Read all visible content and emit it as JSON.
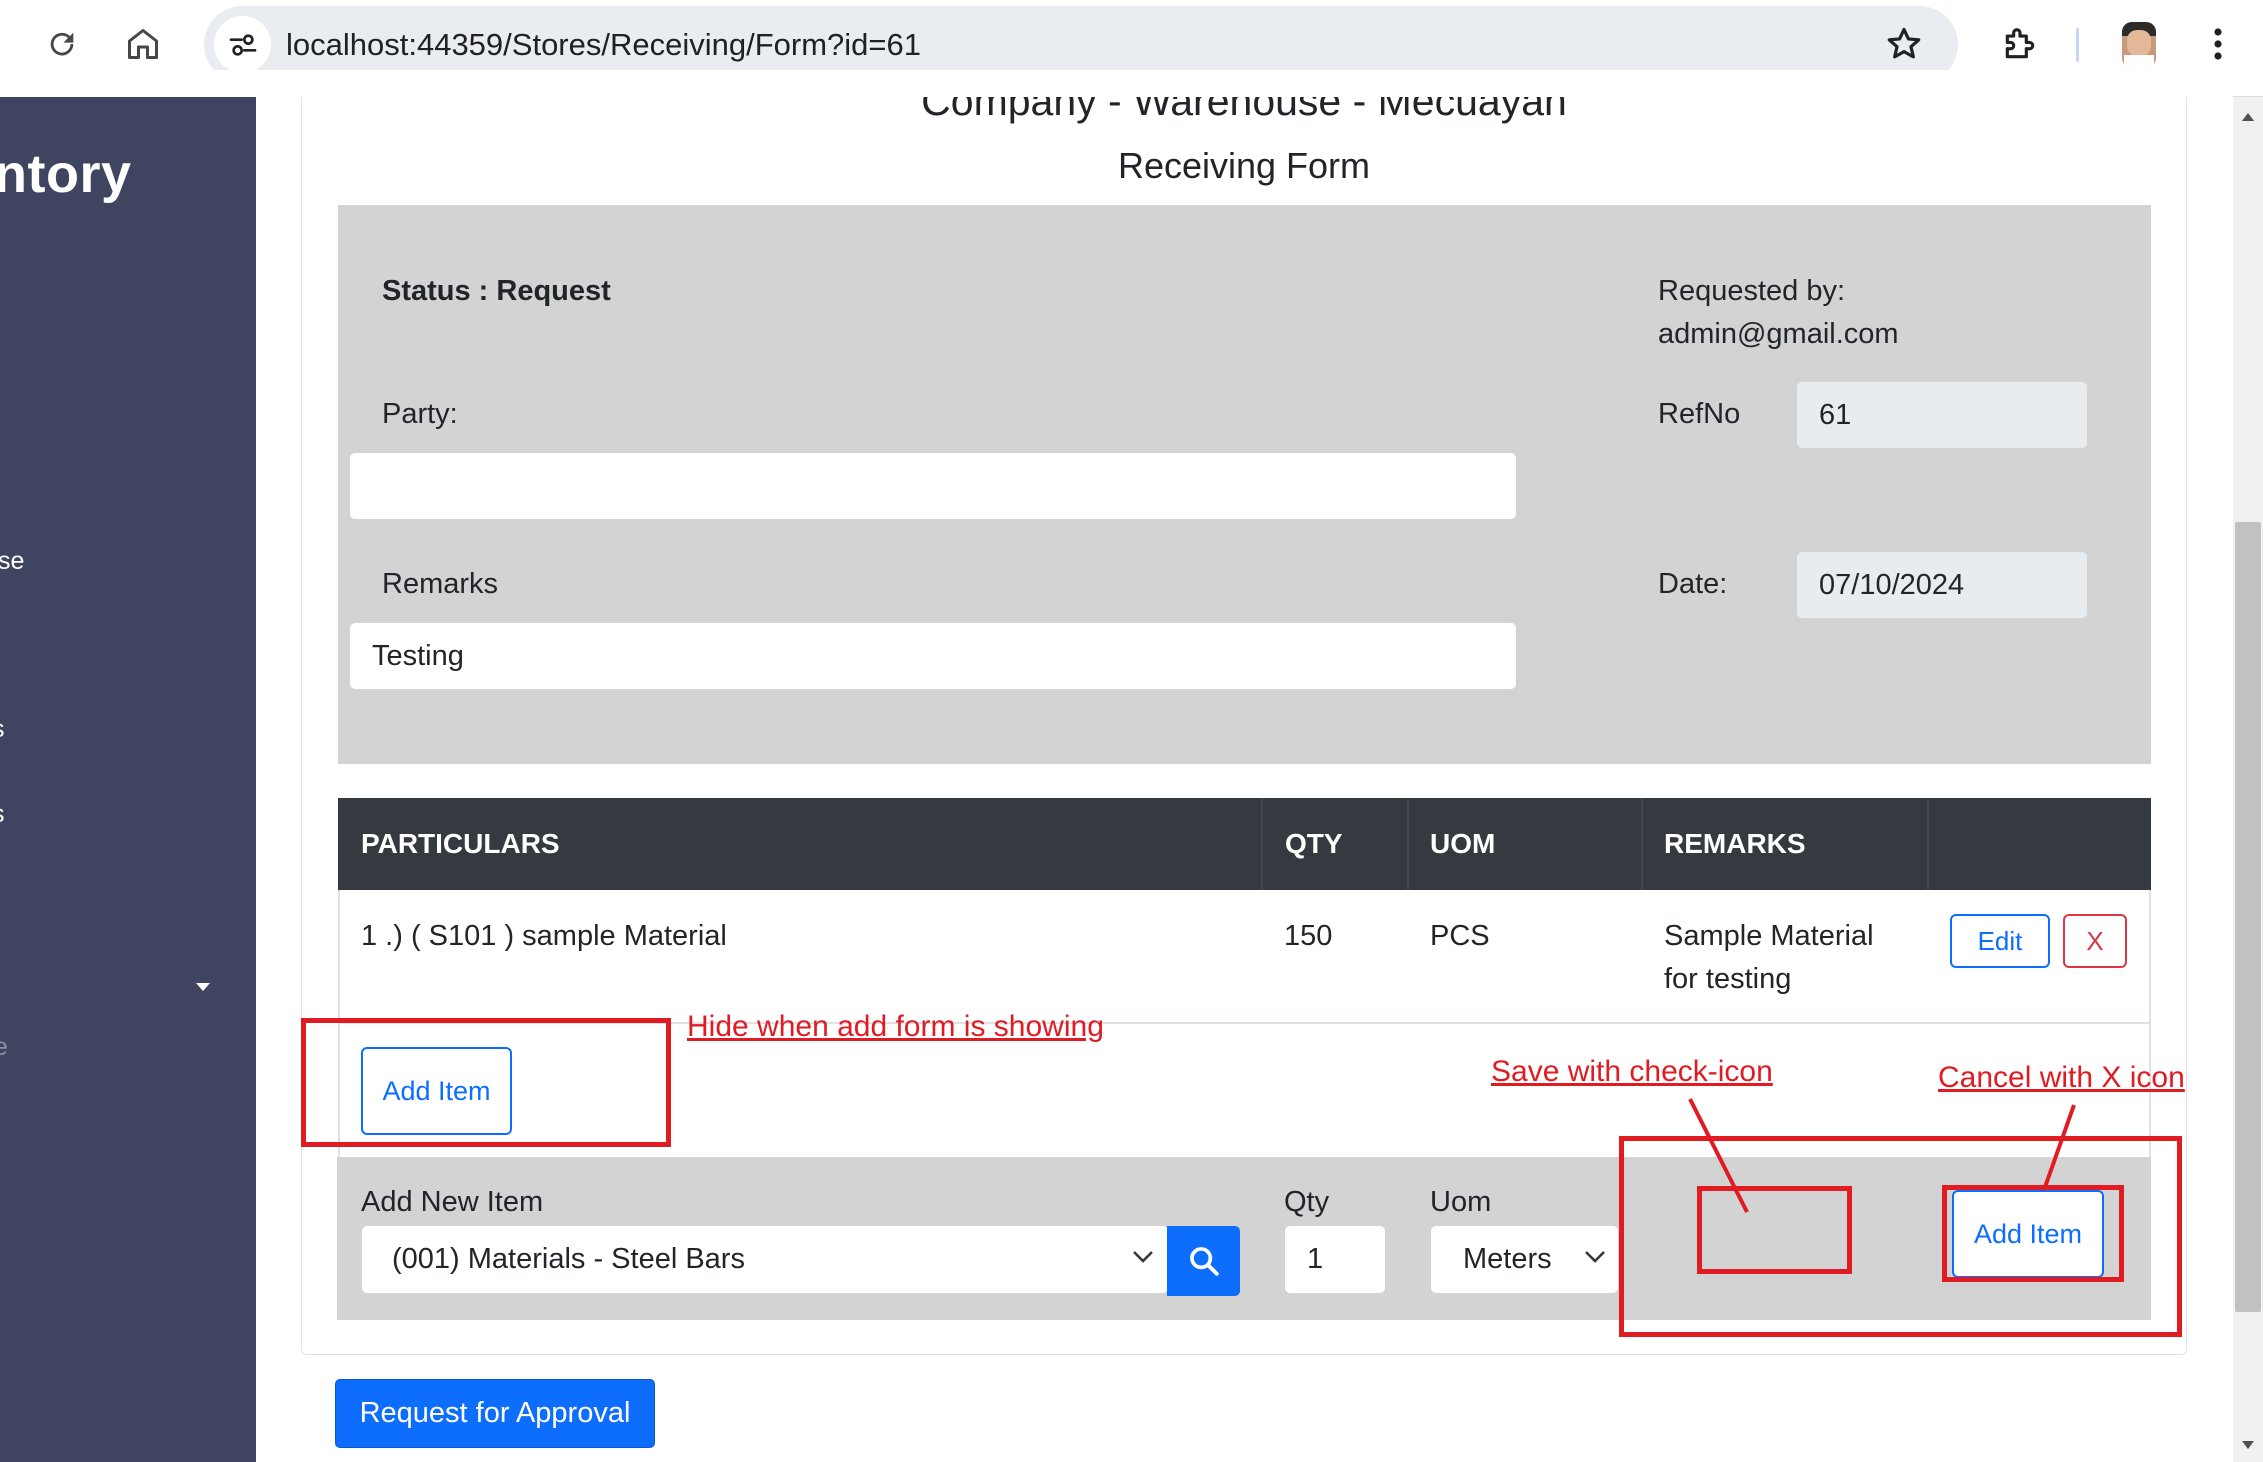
{
  "browser": {
    "url": "localhost:44359/Stores/Receiving/Form?id=61"
  },
  "sidebar": {
    "brand_fragment": "ntory",
    "items": [
      {
        "label": "se"
      },
      {
        "label": "s"
      },
      {
        "label": "s"
      },
      {
        "label": "e"
      }
    ]
  },
  "page": {
    "company_title": "Company - Warehouse - Mecuayan",
    "form_title": "Receiving Form"
  },
  "header_form": {
    "status_label": "Status : Request",
    "requested_by_label": "Requested by:",
    "requested_by_value": "admin@gmail.com",
    "party_label": "Party:",
    "party_value": "",
    "refno_label": "RefNo",
    "refno_value": "61",
    "remarks_label": "Remarks",
    "remarks_value": "Testing",
    "date_label": "Date:",
    "date_value": "07/10/2024"
  },
  "table": {
    "headers": [
      "PARTICULARS",
      "QTY",
      "UOM",
      "REMARKS"
    ],
    "rows": [
      {
        "particulars": "1 .) ( S101 ) sample Material",
        "qty": "150",
        "uom": "PCS",
        "remarks_line1": "Sample Material",
        "remarks_line2": "for testing",
        "edit_label": "Edit",
        "delete_label": "X"
      }
    ],
    "add_item_label": "Add Item"
  },
  "add_form": {
    "item_label": "Add New Item",
    "item_value": "(001) Materials - Steel Bars",
    "qty_label": "Qty",
    "qty_value": "1",
    "uom_label": "Uom",
    "uom_value": "Meters",
    "add_item_label": "Add Item"
  },
  "footer": {
    "approval_label": "Request for Approval"
  },
  "annotations": {
    "hide_note": "Hide when add form is showing",
    "save_note": "Save with check-icon",
    "cancel_note": "Cancel with X icon",
    "color": "#e11b22"
  },
  "colors": {
    "primary": "#0d6efd",
    "danger": "#dc3545",
    "sidebar": "#3f4560",
    "table_header": "#343a40",
    "panel_grey": "#d3d3d3"
  }
}
